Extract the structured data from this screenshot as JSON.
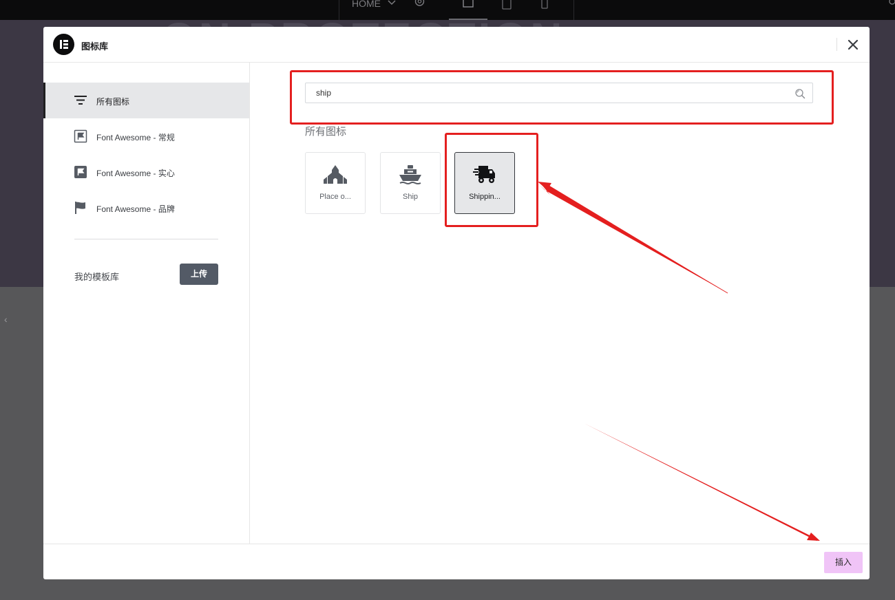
{
  "editor_bg": {
    "nav_label": "HOME",
    "banner_text": "ON PROTECTION"
  },
  "modal": {
    "title": "图标库",
    "close_icon": "close-icon"
  },
  "sidebar": {
    "items": [
      {
        "label": "所有图标",
        "icon": "filter-lines-icon",
        "active": true
      },
      {
        "label": "Font Awesome - 常规",
        "icon": "flag-outline-icon",
        "active": false
      },
      {
        "label": "Font Awesome - 实心",
        "icon": "flag-solid-icon",
        "active": false
      },
      {
        "label": "Font Awesome - 品牌",
        "icon": "flag-brand-icon",
        "active": false
      }
    ],
    "my_library_label": "我的模板库",
    "upload_label": "上传"
  },
  "search": {
    "value": "ship",
    "icon": "search-icon"
  },
  "results": {
    "section_title": "所有图标",
    "icons": [
      {
        "label": "Place o...",
        "icon": "place-of-worship-icon",
        "selected": false
      },
      {
        "label": "Ship",
        "icon": "ship-icon",
        "selected": false
      },
      {
        "label": "Shippin...",
        "icon": "shipping-fast-icon",
        "selected": true
      }
    ]
  },
  "footer": {
    "insert_label": "插入"
  },
  "colors": {
    "accent": "#e41f1f",
    "insert_button": "#f0c4f7",
    "upload_button": "#535a66",
    "icon_grey": "#565b63"
  }
}
